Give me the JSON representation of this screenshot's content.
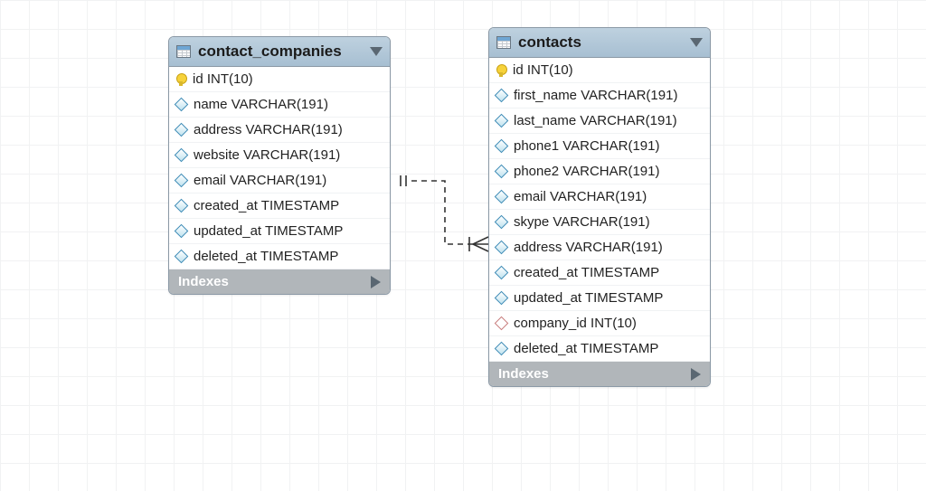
{
  "tables": [
    {
      "id": "tbl1",
      "name": "contact_companies",
      "indexes_label": "Indexes",
      "columns": [
        {
          "icon": "key",
          "text": "id INT(10)"
        },
        {
          "icon": "diamond",
          "text": "name VARCHAR(191)"
        },
        {
          "icon": "diamond",
          "text": "address VARCHAR(191)"
        },
        {
          "icon": "diamond",
          "text": "website VARCHAR(191)"
        },
        {
          "icon": "diamond",
          "text": "email VARCHAR(191)"
        },
        {
          "icon": "diamond",
          "text": "created_at TIMESTAMP"
        },
        {
          "icon": "diamond",
          "text": "updated_at TIMESTAMP"
        },
        {
          "icon": "diamond",
          "text": "deleted_at TIMESTAMP"
        }
      ]
    },
    {
      "id": "tbl2",
      "name": "contacts",
      "indexes_label": "Indexes",
      "columns": [
        {
          "icon": "key",
          "text": "id INT(10)"
        },
        {
          "icon": "diamond",
          "text": "first_name VARCHAR(191)"
        },
        {
          "icon": "diamond",
          "text": "last_name VARCHAR(191)"
        },
        {
          "icon": "diamond",
          "text": "phone1 VARCHAR(191)"
        },
        {
          "icon": "diamond",
          "text": "phone2 VARCHAR(191)"
        },
        {
          "icon": "diamond",
          "text": "email VARCHAR(191)"
        },
        {
          "icon": "diamond",
          "text": "skype VARCHAR(191)"
        },
        {
          "icon": "diamond",
          "text": "address VARCHAR(191)"
        },
        {
          "icon": "diamond",
          "text": "created_at TIMESTAMP"
        },
        {
          "icon": "diamond",
          "text": "updated_at TIMESTAMP"
        },
        {
          "icon": "diamond-open",
          "text": "company_id INT(10)"
        },
        {
          "icon": "diamond",
          "text": "deleted_at TIMESTAMP"
        }
      ]
    }
  ],
  "relationship": {
    "from": "contact_companies.id (one)",
    "to": "contacts.company_id (many)"
  }
}
